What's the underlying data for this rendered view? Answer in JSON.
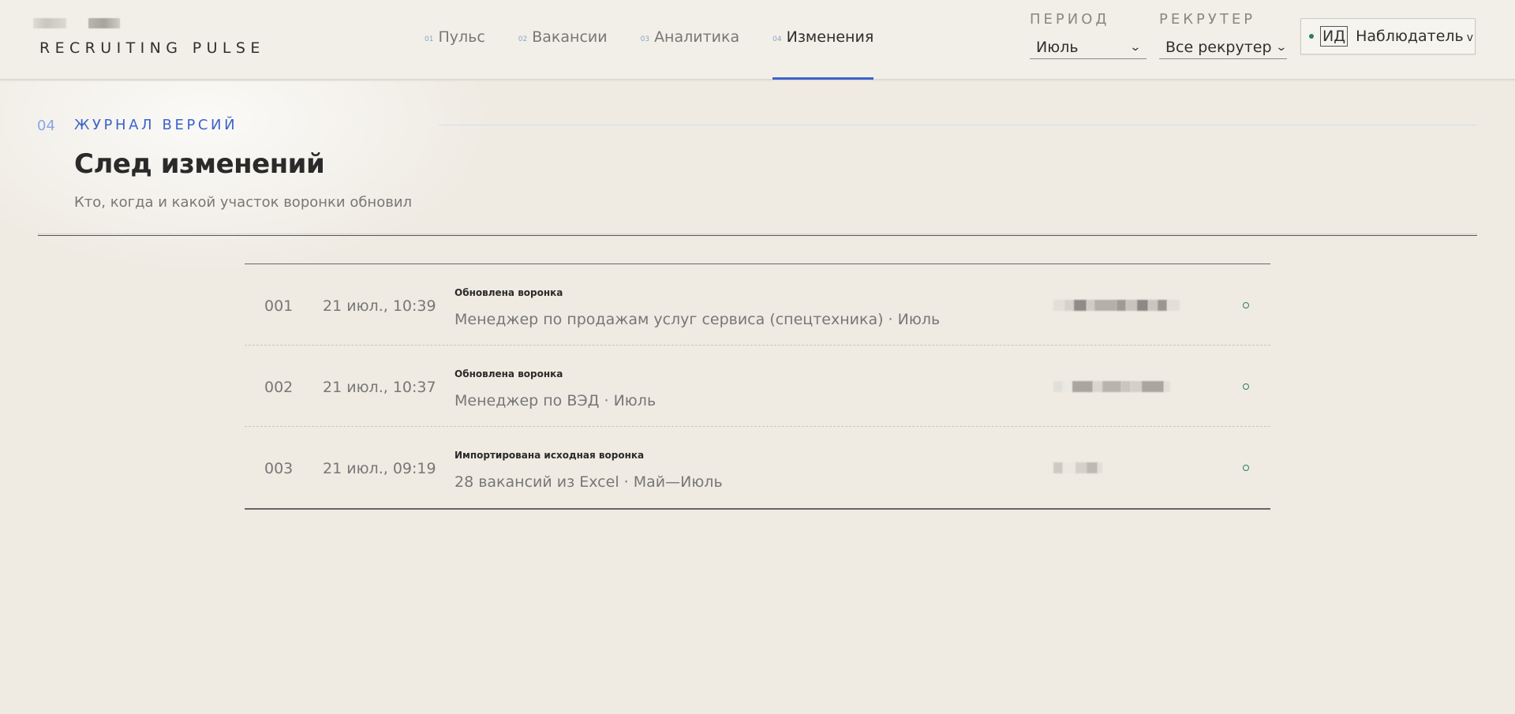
{
  "brand": {
    "name": "RECRUITING PULSE"
  },
  "nav": {
    "tabs": [
      {
        "num": "01",
        "label": "Пульс",
        "active": false
      },
      {
        "num": "02",
        "label": "Вакансии",
        "active": false
      },
      {
        "num": "03",
        "label": "Аналитика",
        "active": false
      },
      {
        "num": "04",
        "label": "Изменения",
        "active": true
      }
    ]
  },
  "filters": {
    "period": {
      "label": "ПЕРИОД",
      "value": "Июль"
    },
    "recruiter": {
      "label": "РЕКРУТЕР",
      "value": "Все рекрутер"
    }
  },
  "user": {
    "initials": "ИД",
    "role": "Наблюдатель",
    "status_color": "#2f7a66"
  },
  "section": {
    "num": "04",
    "label": "ЖУРНАЛ ВЕРСИЙ",
    "title": "След изменений",
    "subtitle": "Кто, когда и какой участок воронки обновил"
  },
  "log": [
    {
      "num": "001",
      "time": "21 июл., 10:39",
      "action": "Обновлена воронка",
      "description": "Менеджер по продажам услуг сервиса (спецтехника) · Июль"
    },
    {
      "num": "002",
      "time": "21 июл., 10:37",
      "action": "Обновлена воронка",
      "description": "Менеджер по ВЭД · Июль"
    },
    {
      "num": "003",
      "time": "21 июл., 09:19",
      "action": "Импортирована исходная воронка",
      "description": "28 вакансий из Excel · Май—Июль"
    }
  ],
  "colors": {
    "accent": "#3b63cc",
    "status": "#2f7a66",
    "background": "#efebe3"
  }
}
